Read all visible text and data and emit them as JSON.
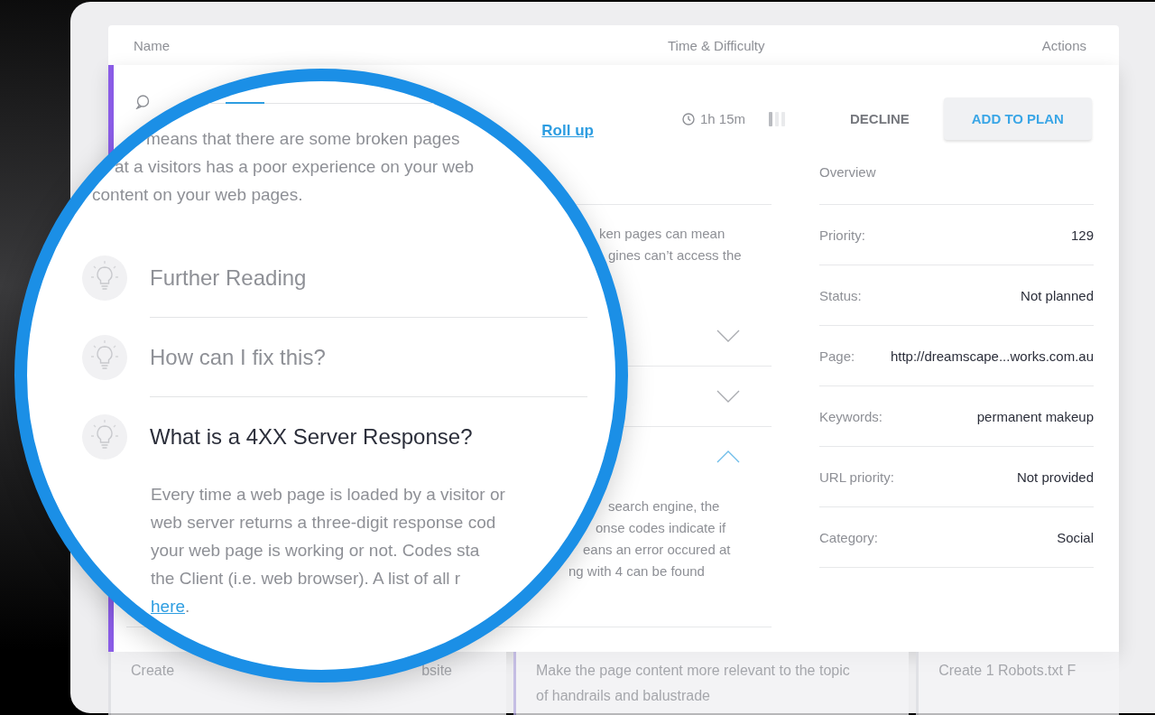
{
  "table_header": {
    "columns": [
      "Name",
      "Time & Difficulty",
      "Actions"
    ]
  },
  "task": {
    "roll_up_link": "Roll up",
    "time": "1h 15m",
    "difficulty": {
      "level": 0.33
    },
    "actions": [
      {
        "label": "DECLINE",
        "kind": "text"
      },
      {
        "label": "ADD TO PLAN",
        "kind": "raised"
      }
    ],
    "description_fragments": [
      "ken pages can mean",
      "gines can’t access the"
    ],
    "sections": [
      {
        "expanded": false
      },
      {
        "expanded": false
      },
      {
        "expanded": true,
        "body_fragments": [
          "search engine, the",
          "onse codes indicate if",
          "eans an error occured at",
          "ng with 4 can be found"
        ]
      }
    ],
    "overview": {
      "title": "Overview",
      "rows": [
        {
          "label": "Priority:",
          "value": "129"
        },
        {
          "label": "Status:",
          "value": "Not planned"
        },
        {
          "label": "Page:",
          "value": "http://dreamscape...works.com.au"
        },
        {
          "label": "Keywords:",
          "value": "permanent makeup"
        },
        {
          "label": "URL priority:",
          "value": "Not provided"
        },
        {
          "label": "Category:",
          "value": "Social"
        }
      ]
    }
  },
  "magnifier": {
    "intro_lines": [
      "means that there are some broken pages",
      "at a visitors has a poor experience on your web",
      "content on your web pages."
    ],
    "sections": [
      {
        "title": "Further Reading",
        "expanded": false
      },
      {
        "title": "How can I fix this?",
        "expanded": false
      },
      {
        "title": "What is a 4XX Server Response?",
        "expanded": true,
        "body_lines": [
          "Every time a web page is loaded by a visitor or",
          "web server returns a three-digit response cod",
          "your web page is working or not. Codes sta",
          "the Client (i.e. web browser). A list of all r"
        ],
        "link": "here",
        "link_suffix": "."
      }
    ]
  },
  "next_tasks": [
    {
      "fragments": [
        "Create",
        "bsite"
      ]
    },
    {
      "fragments": [
        "Make the page content more relevant to the topic of handrails and balustrade"
      ]
    },
    {
      "fragments": [
        "Create 1 Robots.txt F"
      ]
    }
  ]
}
